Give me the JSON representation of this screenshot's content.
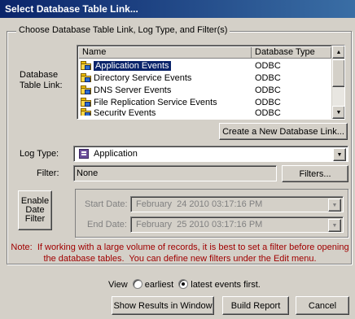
{
  "window": {
    "title": "Select Database Table Link..."
  },
  "group": {
    "legend": "Choose Database Table Link, Log Type, and Filter(s)"
  },
  "db_label": {
    "line1": "Database",
    "line2": "Table Link:"
  },
  "table": {
    "columns": [
      "Name",
      "Database Type"
    ],
    "rows": [
      {
        "name": "Application Events",
        "type": "ODBC",
        "selected": true
      },
      {
        "name": "Directory Service Events",
        "type": "ODBC"
      },
      {
        "name": "DNS Server Events",
        "type": "ODBC"
      },
      {
        "name": "File Replication Service Events",
        "type": "ODBC"
      },
      {
        "name": "Security Events",
        "type": "ODBC"
      }
    ]
  },
  "buttons": {
    "create_link": "Create a New Database Link...",
    "filters": "Filters...",
    "enable_filter": [
      "Enable",
      "Date",
      "Filter"
    ],
    "show_results": "Show Results in Window",
    "build_report": "Build Report",
    "cancel": "Cancel"
  },
  "log_type": {
    "label": "Log Type:",
    "value": "Application"
  },
  "filter": {
    "label": "Filter:",
    "value": "None"
  },
  "dates": {
    "start_label": "Start Date:",
    "start_value": "February  24 2010 03:17:16 PM",
    "end_label": "End Date:",
    "end_value": "February  25 2010 03:17:16 PM"
  },
  "note": {
    "line1": "Note:  If working with a large volume of records, it is best to set a filter before opening",
    "line2": "the database tables.  You can define new filters under the Edit menu."
  },
  "view": {
    "prefix": "View",
    "earliest": "earliest",
    "latest": "latest",
    "suffix": "events first.",
    "selected": "latest"
  },
  "colors": {
    "title_start": "#0a246a",
    "title_end": "#3a6ea5",
    "note": "#a00000",
    "dialog": "#d4d0c8"
  }
}
